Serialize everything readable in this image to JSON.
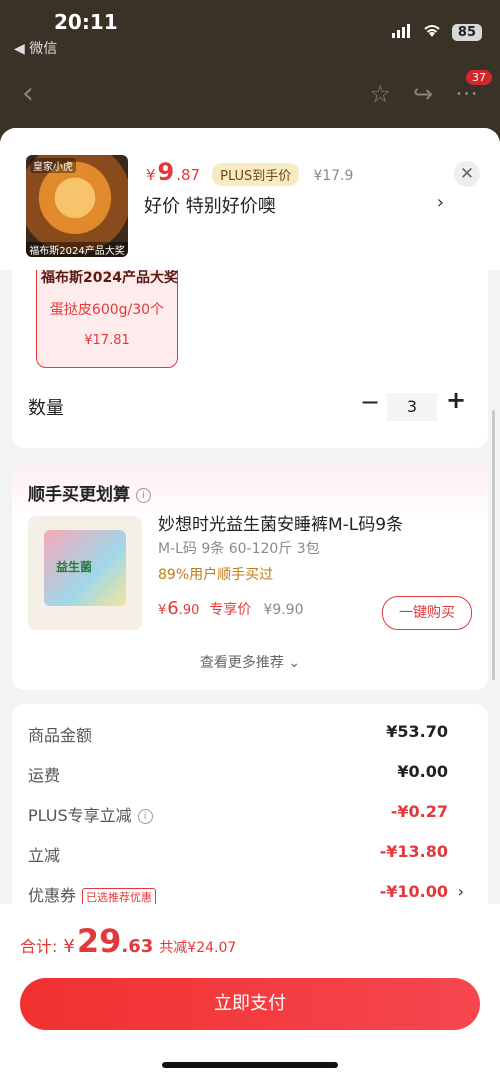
{
  "status": {
    "time": "20:11",
    "back_app": "◀ 微信",
    "battery": "85"
  },
  "nav": {
    "badge": "37"
  },
  "header": {
    "thumb_top": "皇家小虎",
    "thumb_bottom": "福布斯2024产品大奖",
    "price_symbol": "¥",
    "price_int": "9",
    "price_dec": ".87",
    "plus_tag": "PLUS到手价",
    "orig_price": "¥17.9",
    "subtitle": "好价  特别好价噢",
    "close": "✕"
  },
  "spec": {
    "award": "福布斯2024产品大奖",
    "name": "蛋挞皮600g/30个",
    "price": "¥17.81"
  },
  "quantity": {
    "label": "数量",
    "minus": "−",
    "value": "3",
    "plus": "+"
  },
  "recommend": {
    "title": "顺手买更划算",
    "info": "i",
    "image_text": "益生菌",
    "name": "妙想时光益生菌安睡裤M-L码9条",
    "spec": "M-L码 9条 60-120斤 3包",
    "users": "89%用户顺手买过",
    "price_symbol": "¥",
    "price_int": "6",
    "price_dec": ".90",
    "price_tag": "专享价",
    "orig_price": "¥9.90",
    "buy_label": "一键购买",
    "more_label": "查看更多推荐 ⌄"
  },
  "amounts": [
    {
      "label": "商品金额",
      "value": "¥53.70",
      "red": false
    },
    {
      "label": "运费",
      "value": "¥0.00",
      "red": false
    },
    {
      "label": "PLUS专享立减",
      "value": "-¥0.27",
      "red": true
    },
    {
      "label": "立减",
      "value": "-¥13.80",
      "red": true
    },
    {
      "label": "优惠券",
      "value": "-¥10.00",
      "red": true,
      "tag": "已选推荐优惠"
    }
  ],
  "bottom": {
    "total_label": "合计:",
    "total_symbol": "¥",
    "total_int": "29",
    "total_dec": ".63",
    "saved": "共减¥24.07",
    "pay_label": "立即支付"
  },
  "colors": {
    "accent": "#e4393c",
    "plus_gold": "#f8eac2",
    "users_orange": "#c27c18"
  }
}
